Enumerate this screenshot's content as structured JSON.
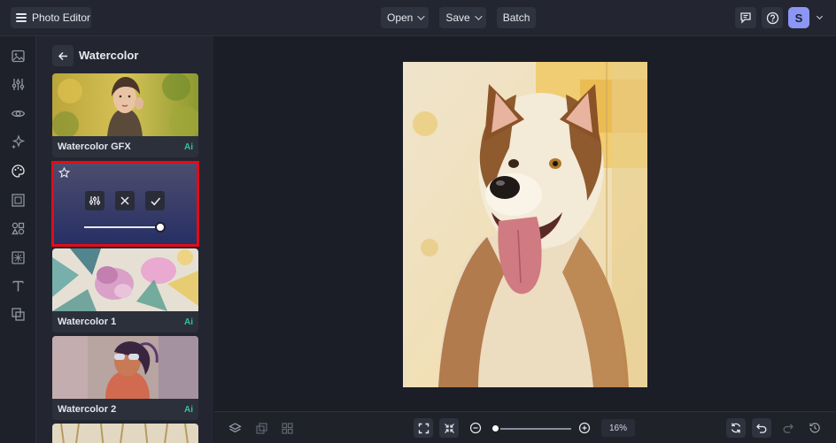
{
  "app": {
    "menu_label": "Photo Editor"
  },
  "toolbar": {
    "open_label": "Open",
    "save_label": "Save",
    "batch_label": "Batch"
  },
  "user": {
    "avatar_letter": "S"
  },
  "panel": {
    "title": "Watercolor",
    "filters": [
      {
        "name": "Watercolor GFX",
        "badge": "Ai"
      },
      {
        "name": "Watercolor 1",
        "badge": "Ai"
      },
      {
        "name": "Watercolor 2",
        "badge": "Ai"
      }
    ],
    "active_filter": {
      "intensity": 1.0
    }
  },
  "zoom": {
    "level_label": "16%",
    "level": 0.0
  },
  "colors": {
    "accent": "#8b96f5",
    "selection": "#e30b17",
    "ai_badge": "#2ec4a0",
    "background": "#1b1e27"
  },
  "icons": {
    "rail": [
      "image-icon",
      "adjustments-icon",
      "eye-icon",
      "sparkle-icon",
      "palette-icon",
      "frame-icon",
      "shapes-icon",
      "texture-icon",
      "text-icon",
      "overlay-icon"
    ],
    "bottom": [
      "layers-icon",
      "compare-icon",
      "grid-icon",
      "fit-screen-icon",
      "actual-size-icon",
      "zoom-out-icon",
      "zoom-in-icon",
      "rotate-icon",
      "undo-icon",
      "redo-icon",
      "history-icon"
    ]
  }
}
